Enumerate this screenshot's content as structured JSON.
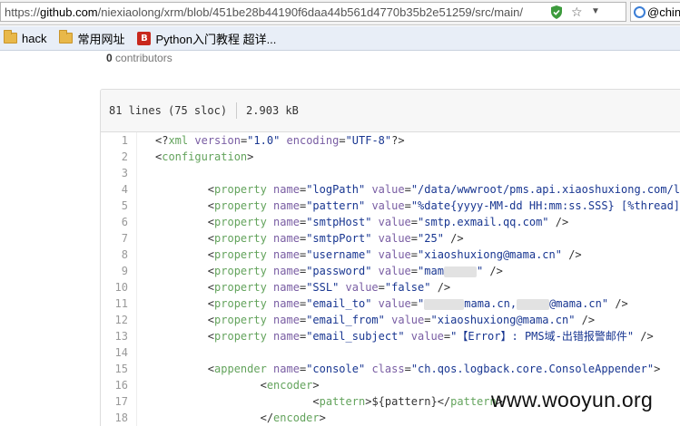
{
  "browser": {
    "url_prefix": "https://",
    "url_host": "github.com",
    "url_path": "/niexiaolong/xrm/blob/451be28b44190f6daa44b561d4770b35b2e51259/src/main/",
    "search_text": "@chin"
  },
  "bookmarks": [
    {
      "label": "hack",
      "icon": "folder-icon"
    },
    {
      "label": "常用网址",
      "icon": "folder-icon"
    },
    {
      "label": "Python入门教程 超详...",
      "icon": "python-tutorial-icon",
      "icon_glyph": "B"
    }
  ],
  "page": {
    "contributors_count": "0",
    "contributors_label": " contributors"
  },
  "file": {
    "lines_info": "81 lines (75 sloc)",
    "size": "2.903 kB"
  },
  "code_lines": [
    {
      "n": "1"
    },
    {
      "n": "2"
    },
    {
      "n": "3"
    },
    {
      "n": "4"
    },
    {
      "n": "5"
    },
    {
      "n": "6"
    },
    {
      "n": "7"
    },
    {
      "n": "8"
    },
    {
      "n": "9"
    },
    {
      "n": "10"
    },
    {
      "n": "11"
    },
    {
      "n": "12"
    },
    {
      "n": "13"
    },
    {
      "n": "14"
    },
    {
      "n": "15"
    },
    {
      "n": "16"
    },
    {
      "n": "17"
    },
    {
      "n": "18"
    }
  ],
  "code": {
    "l1_a": "<?",
    "l1_tag": "xml",
    "l1_attr1": " version",
    "l1_eq1": "=",
    "l1_val1": "\"1.0\"",
    "l1_attr2": " encoding",
    "l1_eq2": "=",
    "l1_val2": "\"UTF-8\"",
    "l1_end": "?>",
    "l2_a": "<",
    "l2_tag": "configuration",
    "l2_end": ">",
    "prop_open": "<",
    "prop_tag": "property",
    "name_attr": " name",
    "value_attr": " value",
    "eq": "=",
    "self_close": " />",
    "space": " ",
    "l4_name": "\"logPath\"",
    "l4_value": "\"/data/wwwroot/pms.api.xiaoshuxiong.com/logs",
    "l5_name": "\"pattern\"",
    "l5_value": "\"%date{yyyy-MM-dd HH:mm:ss.SSS} [%thread] %-",
    "l6_name": "\"smtpHost\"",
    "l6_value": "\"smtp.exmail.qq.com\"",
    "l7_name": "\"smtpPort\"",
    "l7_value": "\"25\"",
    "l8_name": "\"username\"",
    "l8_value": "\"xiaoshuxiong@mama.cn\"",
    "l9_name": "\"password\"",
    "l9_value_a": "\"mam",
    "l9_value_b": "\"",
    "l10_name": "\"SSL\"",
    "l10_value": "\"false\"",
    "l11_name": "\"email_to\"",
    "l11_value_a": "\"",
    "l11_value_b": "mama.cn,",
    "l11_value_c": "@mama.cn\"",
    "l12_name": "\"email_from\"",
    "l12_value": "\"xiaoshuxiong@mama.cn\"",
    "l13_name": "\"email_subject\"",
    "l13_value": "\"【Error】: PMS域-出错报警邮件\"",
    "l15_tag": "appender",
    "l15_class_attr": " class",
    "l15_name": "\"console\"",
    "l15_class": "\"ch.qos.logback.core.ConsoleAppender\"",
    "gt": ">",
    "l16_tag": "encoder",
    "l17_tag": "pattern",
    "l17_text": "${pattern}",
    "close_open": "</",
    "l18_tag": "encoder"
  },
  "watermark": "www.wooyun.org"
}
